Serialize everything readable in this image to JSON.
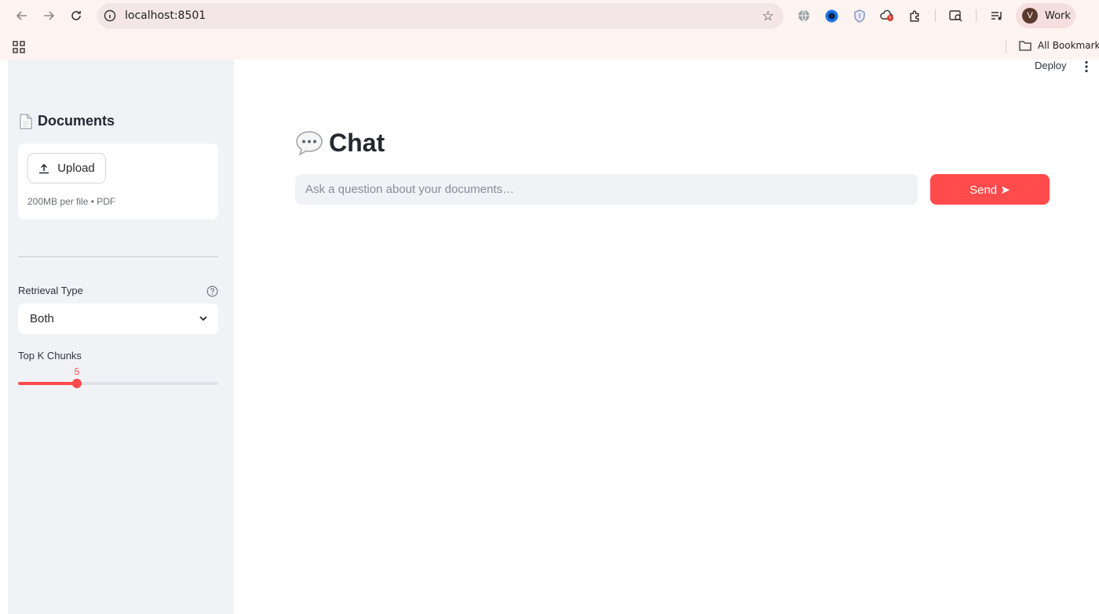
{
  "browser": {
    "url": "localhost:8501",
    "profile_initial": "V",
    "profile_name": "Work",
    "bookmarks_label": "All Bookmarks"
  },
  "header": {
    "deploy_label": "Deploy"
  },
  "sidebar": {
    "documents_title": "Documents",
    "upload_label": "Upload",
    "upload_hint": "200MB per file • PDF",
    "retrieval_label": "Retrieval Type",
    "retrieval_value": "Both",
    "topk_label": "Top K Chunks",
    "topk_value": "5",
    "topk_fraction": 0.294
  },
  "main": {
    "title": "Chat",
    "input_placeholder": "Ask a question about your documents…",
    "send_label": "Send ➤"
  },
  "colors": {
    "accent": "#ff4b4b",
    "sidebar_bg": "#f0f2f6",
    "chrome_bg": "#fdf3f1"
  }
}
